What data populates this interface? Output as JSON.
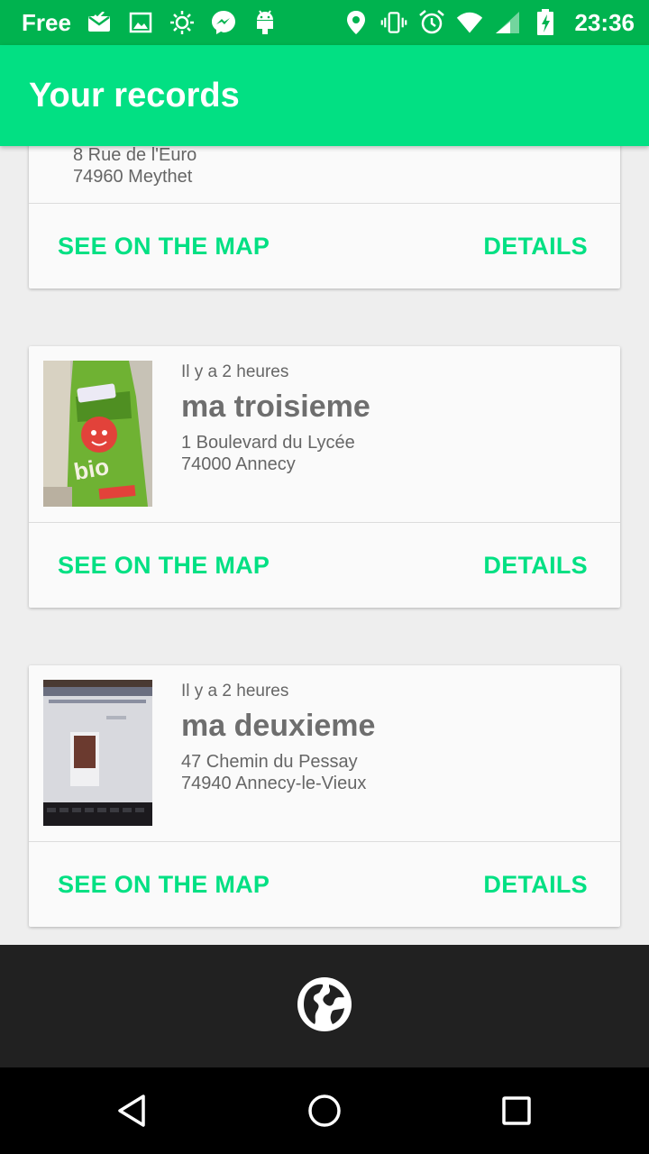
{
  "status_bar": {
    "carrier": "Free",
    "time": "23:36",
    "icons": [
      "mail-icon",
      "image-icon",
      "brightness-icon",
      "messenger-icon",
      "android-icon",
      "location-icon",
      "vibrate-icon",
      "alarm-icon",
      "wifi-icon",
      "signal-icon",
      "battery-charging-icon"
    ]
  },
  "app_bar": {
    "title": "Your records"
  },
  "records": [
    {
      "address_line1": "8 Rue de l'Euro",
      "address_line2": "74960 Meythet",
      "map_label": "SEE ON THE MAP",
      "details_label": "DETAILS"
    },
    {
      "time": "Il y a 2 heures",
      "title": "ma troisieme",
      "address_line1": "1 Boulevard du Lycée",
      "address_line2": "74000 Annecy",
      "map_label": "SEE ON THE MAP",
      "details_label": "DETAILS"
    },
    {
      "time": "Il y a 2 heures",
      "title": "ma deuxieme",
      "address_line1": "47 Chemin du Pessay",
      "address_line2": "74940 Annecy-le-Vieux",
      "map_label": "SEE ON THE MAP",
      "details_label": "DETAILS"
    }
  ],
  "bottom_bar": {
    "icon": "globe-icon"
  },
  "nav_bar": {
    "icons": [
      "back-icon",
      "home-icon",
      "recents-icon"
    ]
  },
  "colors": {
    "status_bar": "#00b34f",
    "app_bar": "#02e083",
    "accent": "#02e083",
    "bottom_bar": "#212121"
  }
}
